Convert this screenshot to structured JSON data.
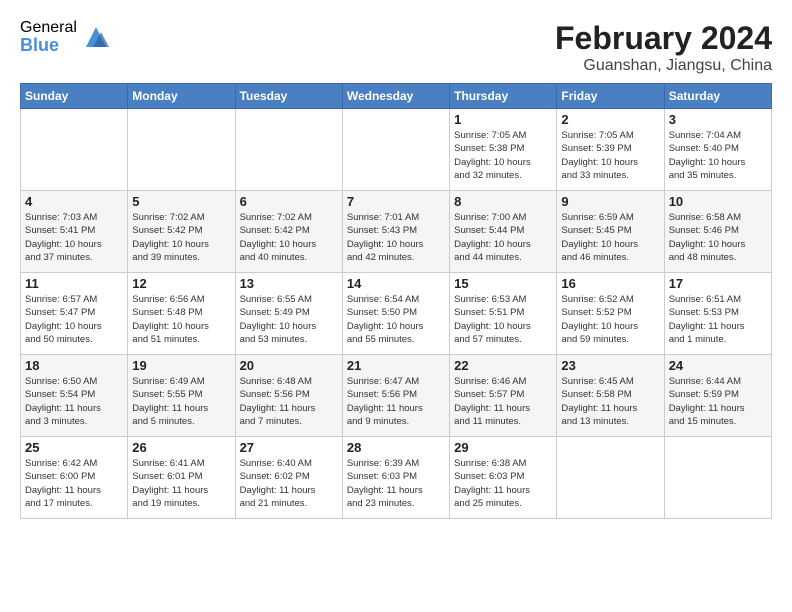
{
  "logo": {
    "general": "General",
    "blue": "Blue"
  },
  "header": {
    "month_year": "February 2024",
    "location": "Guanshan, Jiangsu, China"
  },
  "weekdays": [
    "Sunday",
    "Monday",
    "Tuesday",
    "Wednesday",
    "Thursday",
    "Friday",
    "Saturday"
  ],
  "weeks": [
    [
      {
        "day": "",
        "info": ""
      },
      {
        "day": "",
        "info": ""
      },
      {
        "day": "",
        "info": ""
      },
      {
        "day": "",
        "info": ""
      },
      {
        "day": "1",
        "info": "Sunrise: 7:05 AM\nSunset: 5:38 PM\nDaylight: 10 hours\nand 32 minutes."
      },
      {
        "day": "2",
        "info": "Sunrise: 7:05 AM\nSunset: 5:39 PM\nDaylight: 10 hours\nand 33 minutes."
      },
      {
        "day": "3",
        "info": "Sunrise: 7:04 AM\nSunset: 5:40 PM\nDaylight: 10 hours\nand 35 minutes."
      }
    ],
    [
      {
        "day": "4",
        "info": "Sunrise: 7:03 AM\nSunset: 5:41 PM\nDaylight: 10 hours\nand 37 minutes."
      },
      {
        "day": "5",
        "info": "Sunrise: 7:02 AM\nSunset: 5:42 PM\nDaylight: 10 hours\nand 39 minutes."
      },
      {
        "day": "6",
        "info": "Sunrise: 7:02 AM\nSunset: 5:42 PM\nDaylight: 10 hours\nand 40 minutes."
      },
      {
        "day": "7",
        "info": "Sunrise: 7:01 AM\nSunset: 5:43 PM\nDaylight: 10 hours\nand 42 minutes."
      },
      {
        "day": "8",
        "info": "Sunrise: 7:00 AM\nSunset: 5:44 PM\nDaylight: 10 hours\nand 44 minutes."
      },
      {
        "day": "9",
        "info": "Sunrise: 6:59 AM\nSunset: 5:45 PM\nDaylight: 10 hours\nand 46 minutes."
      },
      {
        "day": "10",
        "info": "Sunrise: 6:58 AM\nSunset: 5:46 PM\nDaylight: 10 hours\nand 48 minutes."
      }
    ],
    [
      {
        "day": "11",
        "info": "Sunrise: 6:57 AM\nSunset: 5:47 PM\nDaylight: 10 hours\nand 50 minutes."
      },
      {
        "day": "12",
        "info": "Sunrise: 6:56 AM\nSunset: 5:48 PM\nDaylight: 10 hours\nand 51 minutes."
      },
      {
        "day": "13",
        "info": "Sunrise: 6:55 AM\nSunset: 5:49 PM\nDaylight: 10 hours\nand 53 minutes."
      },
      {
        "day": "14",
        "info": "Sunrise: 6:54 AM\nSunset: 5:50 PM\nDaylight: 10 hours\nand 55 minutes."
      },
      {
        "day": "15",
        "info": "Sunrise: 6:53 AM\nSunset: 5:51 PM\nDaylight: 10 hours\nand 57 minutes."
      },
      {
        "day": "16",
        "info": "Sunrise: 6:52 AM\nSunset: 5:52 PM\nDaylight: 10 hours\nand 59 minutes."
      },
      {
        "day": "17",
        "info": "Sunrise: 6:51 AM\nSunset: 5:53 PM\nDaylight: 11 hours\nand 1 minute."
      }
    ],
    [
      {
        "day": "18",
        "info": "Sunrise: 6:50 AM\nSunset: 5:54 PM\nDaylight: 11 hours\nand 3 minutes."
      },
      {
        "day": "19",
        "info": "Sunrise: 6:49 AM\nSunset: 5:55 PM\nDaylight: 11 hours\nand 5 minutes."
      },
      {
        "day": "20",
        "info": "Sunrise: 6:48 AM\nSunset: 5:56 PM\nDaylight: 11 hours\nand 7 minutes."
      },
      {
        "day": "21",
        "info": "Sunrise: 6:47 AM\nSunset: 5:56 PM\nDaylight: 11 hours\nand 9 minutes."
      },
      {
        "day": "22",
        "info": "Sunrise: 6:46 AM\nSunset: 5:57 PM\nDaylight: 11 hours\nand 11 minutes."
      },
      {
        "day": "23",
        "info": "Sunrise: 6:45 AM\nSunset: 5:58 PM\nDaylight: 11 hours\nand 13 minutes."
      },
      {
        "day": "24",
        "info": "Sunrise: 6:44 AM\nSunset: 5:59 PM\nDaylight: 11 hours\nand 15 minutes."
      }
    ],
    [
      {
        "day": "25",
        "info": "Sunrise: 6:42 AM\nSunset: 6:00 PM\nDaylight: 11 hours\nand 17 minutes."
      },
      {
        "day": "26",
        "info": "Sunrise: 6:41 AM\nSunset: 6:01 PM\nDaylight: 11 hours\nand 19 minutes."
      },
      {
        "day": "27",
        "info": "Sunrise: 6:40 AM\nSunset: 6:02 PM\nDaylight: 11 hours\nand 21 minutes."
      },
      {
        "day": "28",
        "info": "Sunrise: 6:39 AM\nSunset: 6:03 PM\nDaylight: 11 hours\nand 23 minutes."
      },
      {
        "day": "29",
        "info": "Sunrise: 6:38 AM\nSunset: 6:03 PM\nDaylight: 11 hours\nand 25 minutes."
      },
      {
        "day": "",
        "info": ""
      },
      {
        "day": "",
        "info": ""
      }
    ]
  ]
}
